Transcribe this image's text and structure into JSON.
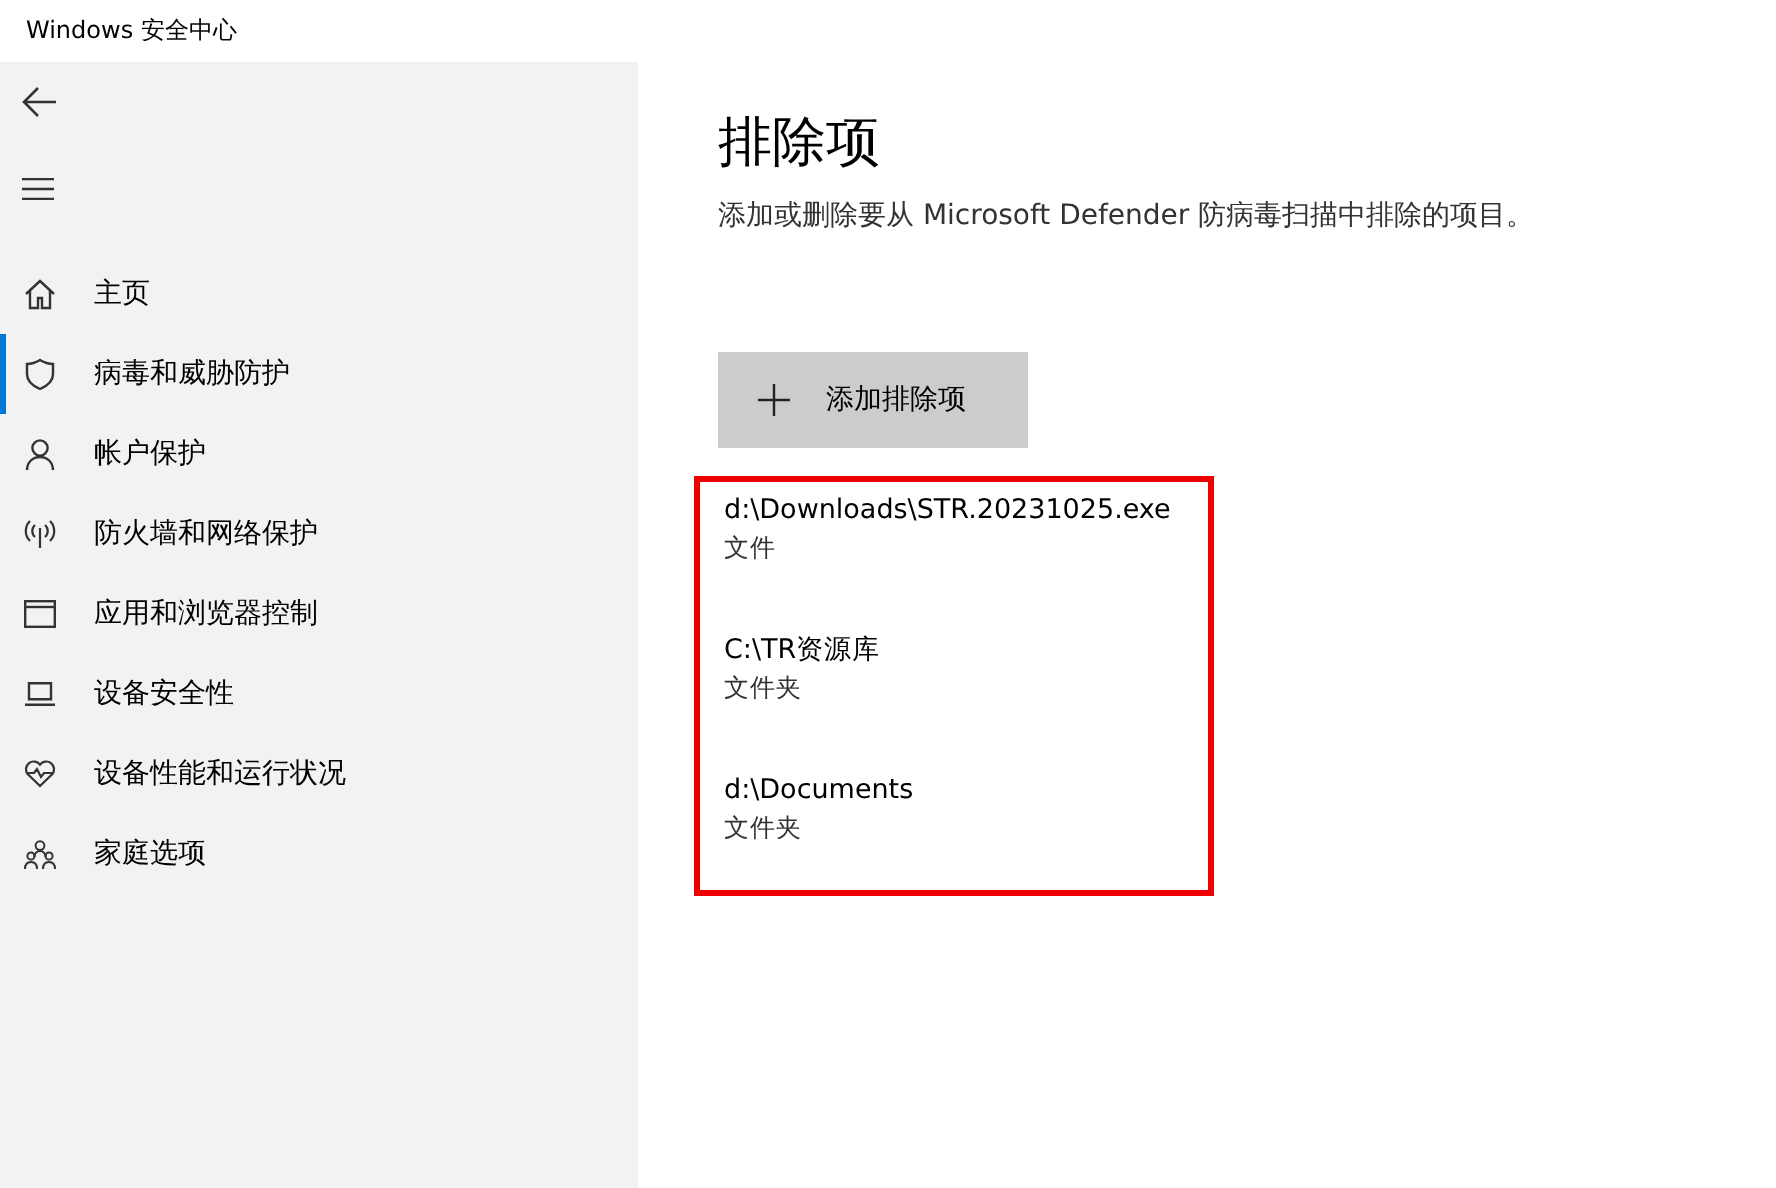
{
  "window": {
    "title": "Windows 安全中心"
  },
  "sidebar": {
    "items": [
      {
        "label": "主页",
        "kind": "home",
        "selected": false
      },
      {
        "label": "病毒和威胁防护",
        "kind": "shield",
        "selected": true
      },
      {
        "label": "帐户保护",
        "kind": "person",
        "selected": false
      },
      {
        "label": "防火墙和网络保护",
        "kind": "antenna",
        "selected": false
      },
      {
        "label": "应用和浏览器控制",
        "kind": "window",
        "selected": false
      },
      {
        "label": "设备安全性",
        "kind": "laptop",
        "selected": false
      },
      {
        "label": "设备性能和运行状况",
        "kind": "heart",
        "selected": false
      },
      {
        "label": "家庭选项",
        "kind": "family",
        "selected": false
      }
    ]
  },
  "page": {
    "title": "排除项",
    "description": "添加或删除要从 Microsoft Defender 防病毒扫描中排除的项目。",
    "add_button": "添加排除项",
    "exclusions": [
      {
        "path": "d:\\Downloads\\STR.20231025.exe",
        "type": "文件"
      },
      {
        "path": "C:\\TR资源库",
        "type": "文件夹"
      },
      {
        "path": "d:\\Documents",
        "type": "文件夹"
      }
    ]
  }
}
